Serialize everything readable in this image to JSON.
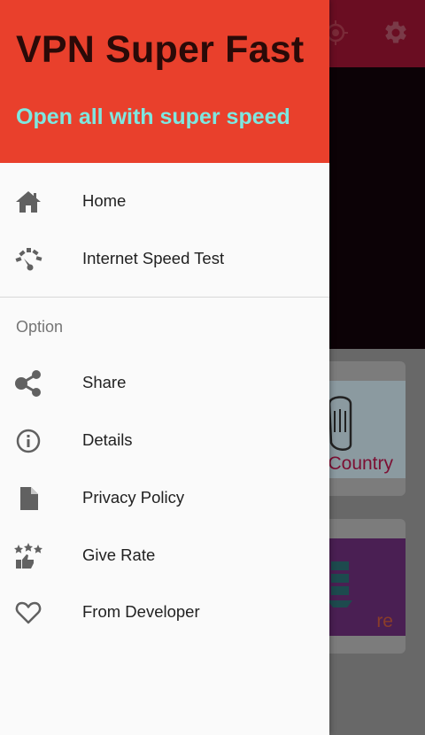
{
  "background_app": {
    "card_country_label": "Country",
    "card_more_label": "re"
  },
  "drawer": {
    "title": "VPN Super Fast",
    "subtitle": "Open all with super speed",
    "items": [
      {
        "label": "Home",
        "icon": "home-icon"
      },
      {
        "label": "Internet Speed Test",
        "icon": "speedometer-icon"
      }
    ],
    "section_label": "Option",
    "option_items": [
      {
        "label": "Share",
        "icon": "share-icon"
      },
      {
        "label": "Details",
        "icon": "info-icon"
      },
      {
        "label": "Privacy Policy",
        "icon": "document-icon"
      },
      {
        "label": "Give Rate",
        "icon": "rate-stars-icon"
      },
      {
        "label": "From Developer",
        "icon": "heart-icon"
      }
    ]
  },
  "colors": {
    "header_bg": "#e9402c",
    "title": "#2a0a08",
    "subtitle": "#7ee7e0",
    "icon": "#616161",
    "scrim_toolbar": "#6a0d22"
  }
}
